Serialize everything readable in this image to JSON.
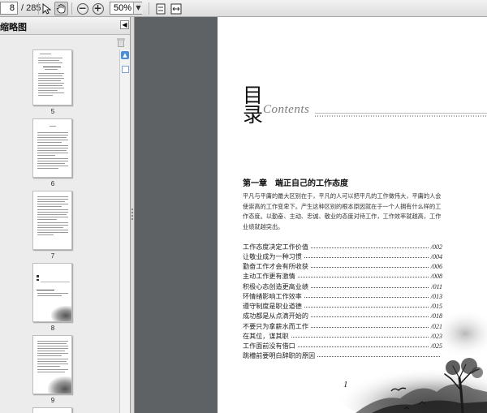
{
  "toolbar": {
    "current_page": "8",
    "total_pages": "/ 285",
    "zoom": "50%",
    "icons": [
      "select-cursor-icon",
      "hand-tool-icon",
      "zoom-out-icon",
      "zoom-in-icon",
      "zoom-dropdown-icon",
      "fit-page-icon",
      "fit-width-icon"
    ]
  },
  "sidebar": {
    "title": "缩略图",
    "thumbnails": [
      {
        "label": "5"
      },
      {
        "label": "6"
      },
      {
        "label": "7"
      },
      {
        "label": "8"
      },
      {
        "label": "9"
      }
    ]
  },
  "document": {
    "heading_top": "目",
    "heading_bottom": "录",
    "heading_en": "Contents",
    "chapter_title": "第一章　端正自己的工作态度",
    "intro": "平凡与平庸的最大区别在于，平凡的人可以把平凡的工作做伟大，平庸的人会使崇高的工作变卑下。产生这种区别的根本原因就在于一个人拥有什么样的工作态度。以勤奋、主动、忠诚、敬业的态度对待工作，工作效率就越高，工作业绩就越突出。",
    "toc": [
      {
        "title": "工作态度决定工作价值",
        "page": "/002"
      },
      {
        "title": "让敬业成为一种习惯",
        "page": "/004"
      },
      {
        "title": "勤奋工作才会有所收获",
        "page": "/006"
      },
      {
        "title": "主动工作更有激情",
        "page": "/008"
      },
      {
        "title": "积极心态创造更高业绩",
        "page": "/011"
      },
      {
        "title": "环情绪影响工作效率",
        "page": "/013"
      },
      {
        "title": "遵守制度是职业道德",
        "page": "/015"
      },
      {
        "title": "成功都是从点滴开始的",
        "page": "/018"
      },
      {
        "title": "不要只为拿薪水而工作",
        "page": "/021"
      },
      {
        "title": "在其位，谋其职",
        "page": "/023"
      },
      {
        "title": "工作面前没有借口",
        "page": "/025"
      },
      {
        "title": "跳槽前要明白辞职的原因",
        "page": ""
      }
    ],
    "page_number": "1"
  }
}
